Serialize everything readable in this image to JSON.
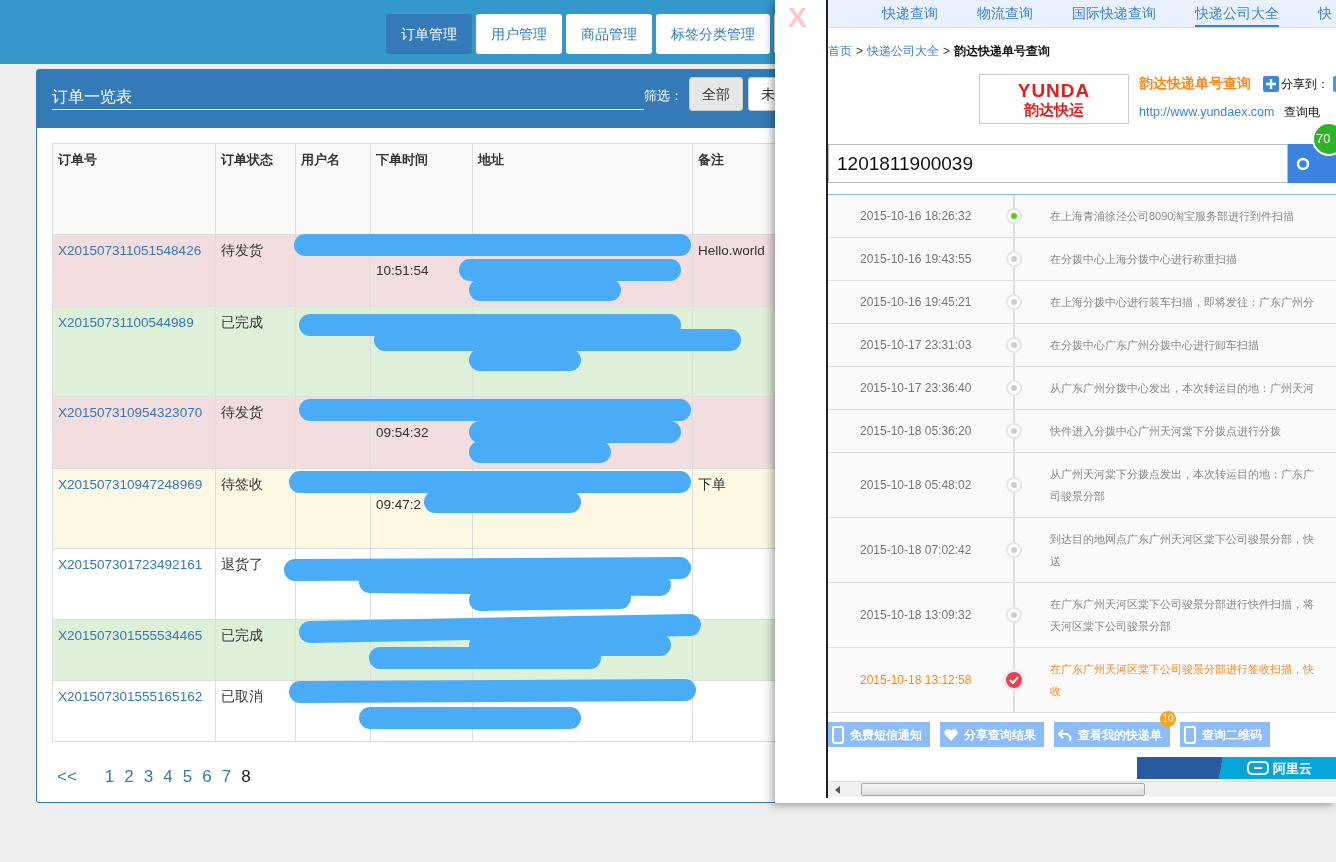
{
  "nav": [
    {
      "label": "订单管理",
      "selected": true
    },
    {
      "label": "用户管理",
      "selected": false
    },
    {
      "label": "商品管理",
      "selected": false
    },
    {
      "label": "标签分类管理",
      "selected": false
    }
  ],
  "panel": {
    "title": "订单一览表",
    "filter_label": "筛选：",
    "filters": [
      {
        "label": "全部",
        "selected": true
      },
      {
        "label": "未",
        "selected": false
      }
    ]
  },
  "table": {
    "columns": [
      "订单号",
      "订单状态",
      "用户名",
      "下单时间",
      "地址",
      "备注"
    ],
    "rows": [
      {
        "order_no": "X201507311051548426",
        "status": "待发货",
        "time": "10:51:54",
        "remark": "Hello.world",
        "kind": "danger"
      },
      {
        "order_no": "X20150731100544989",
        "status": "已完成",
        "kind": "success"
      },
      {
        "order_no": "X201507310954323070",
        "status": "待发货",
        "time": "09:54:32",
        "kind": "danger"
      },
      {
        "order_no": "X201507310947248969",
        "status": "待签收",
        "time": "09:47:2",
        "remark": "下单",
        "kind": "warning"
      },
      {
        "order_no": "X201507301723492161",
        "status": "退货了",
        "kind": "plain"
      },
      {
        "order_no": "X201507301555534465",
        "status": "已完成",
        "kind": "success"
      },
      {
        "order_no": "X201507301555165162",
        "status": "已取消",
        "kind": "plain"
      }
    ]
  },
  "pagination": {
    "prev": "<<",
    "pages": [
      {
        "label": "1",
        "selected": false
      },
      {
        "label": "2",
        "selected": false
      },
      {
        "label": "3",
        "selected": false
      },
      {
        "label": "4",
        "selected": false
      },
      {
        "label": "5",
        "selected": false
      },
      {
        "label": "6",
        "selected": false
      },
      {
        "label": "7",
        "selected": false
      },
      {
        "label": "8",
        "selected": true
      }
    ]
  },
  "popup": {
    "close": "X",
    "tabs": [
      {
        "label": "快递查询",
        "selected": false
      },
      {
        "label": "物流查询",
        "selected": false
      },
      {
        "label": "国际快递查询",
        "selected": false
      },
      {
        "label": "快递公司大全",
        "selected": true
      },
      {
        "label": "快"
      }
    ],
    "breadcrumb": [
      {
        "label": "首页",
        "kind": "link"
      },
      {
        "label": ">",
        "kind": "separator"
      },
      {
        "label": "快递公司大全",
        "kind": "link"
      },
      {
        "label": ">",
        "kind": "separator"
      },
      {
        "label": "韵达快递单号查询",
        "kind": "current"
      }
    ],
    "logo": {
      "brand": "YUNDA",
      "name": "韵达快运"
    },
    "title": "韵达快递单号查询",
    "share": "分享到：",
    "url": "http://www.yundaex.com",
    "phone_label": "查询电",
    "badge": "70",
    "search": {
      "value": "1201811900039"
    },
    "tracking": [
      {
        "time": "2015-10-16 18:26:32",
        "lines": [
          "在上海青浦徐泾公司8090淘宝服务部进行到件扫描"
        ],
        "kind": "first"
      },
      {
        "time": "2015-10-16 19:43:55",
        "lines": [
          "在分拨中心上海分拨中心进行称重扫描"
        ],
        "kind": "normal"
      },
      {
        "time": "2015-10-16 19:45:21",
        "lines": [
          "在上海分拨中心进行装车扫描，即将发往：广东广州分"
        ],
        "kind": "normal"
      },
      {
        "time": "2015-10-17 23:31:03",
        "lines": [
          "在分拨中心广东广州分拨中心进行卸车扫描"
        ],
        "kind": "normal"
      },
      {
        "time": "2015-10-17 23:36:40",
        "lines": [
          "从广东广州分拨中心发出，本次转运目的地：广州天河"
        ],
        "kind": "normal"
      },
      {
        "time": "2015-10-18 05:36:20",
        "lines": [
          "快件进入分拨中心广州天河棠下分拨点进行分拨"
        ],
        "kind": "normal"
      },
      {
        "time": "2015-10-18 05:48:02",
        "lines": [
          "从广州天河棠下分拨点发出，本次转运目的地：广东广",
          "司骏景分部"
        ],
        "kind": "normal"
      },
      {
        "time": "2015-10-18 07:02:42",
        "lines": [
          "到达目的地网点广东广州天河区棠下公司骏景分部，快",
          "送"
        ],
        "kind": "normal"
      },
      {
        "time": "2015-10-18 13:09:32",
        "lines": [
          "在广东广州天河区棠下公司骏景分部进行快件扫描，将",
          "天河区棠下公司骏景分部"
        ],
        "kind": "normal"
      },
      {
        "time": "2015-10-18 13:12:58",
        "lines": [
          "在广东广州天河区棠下公司骏景分部进行签收扫描，快",
          "收"
        ],
        "kind": "signed"
      }
    ],
    "actions": [
      {
        "label": "免费短信通知",
        "kind": "phone"
      },
      {
        "label": "分享查询结果",
        "kind": "heart"
      },
      {
        "label": "查看我的快递单",
        "kind": "reply",
        "badge": "10"
      },
      {
        "label": "查询二维码",
        "kind": "phone"
      }
    ],
    "ad": {
      "text": "阿里云"
    }
  }
}
